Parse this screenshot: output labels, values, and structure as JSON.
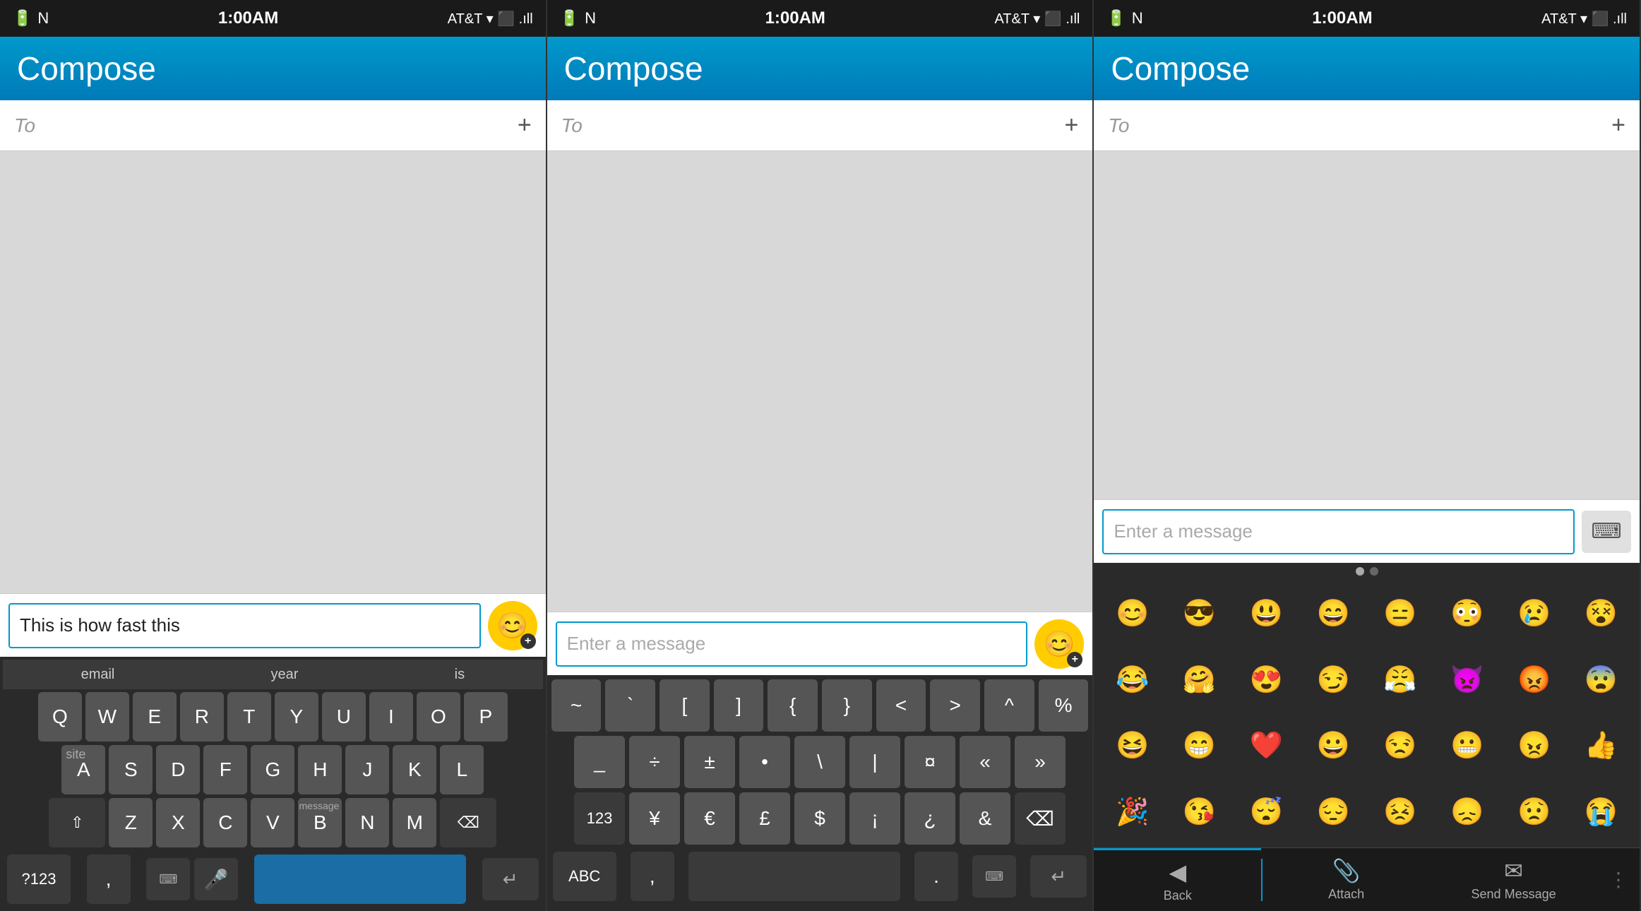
{
  "panels": [
    {
      "id": "panel1",
      "statusBar": {
        "left": "🔇 N",
        "time": "1:00AM",
        "right": "AT&T ▾ ⬛ .ıll"
      },
      "header": {
        "title": "Compose"
      },
      "toLabel": "To",
      "toPlus": "+",
      "messageInput": {
        "value": "This is how fast this",
        "placeholder": ""
      },
      "wordHints": [
        "email",
        "year",
        "is"
      ],
      "keyboard": "qwerty",
      "rows": [
        [
          "Q",
          "W",
          "E",
          "R",
          "T",
          "Y",
          "U",
          "I",
          "O",
          "P"
        ],
        [
          "A",
          "S",
          "D",
          "F",
          "G",
          "H",
          "J",
          "K",
          "L"
        ],
        [
          "⇧",
          "Z",
          "X",
          "C",
          "V",
          "B",
          "N",
          "M",
          "⌫"
        ]
      ],
      "bottomKeys": [
        "?123",
        ",",
        "⎵",
        "⌨",
        "🎤",
        "↵"
      ]
    },
    {
      "id": "panel2",
      "statusBar": {
        "left": "🔇 N",
        "time": "1:00AM",
        "right": "AT&T ▾ ⬛ .ıll"
      },
      "header": {
        "title": "Compose"
      },
      "toLabel": "To",
      "toPlus": "+",
      "messageInput": {
        "value": "",
        "placeholder": "Enter a message"
      },
      "keyboard": "symbol",
      "symRows": [
        [
          "~",
          "`",
          "[",
          "]",
          "{",
          "}",
          "<",
          ">",
          "^",
          "%"
        ],
        [
          "_",
          "÷",
          "±",
          "•",
          "\\",
          "|",
          "¤",
          "«",
          "»"
        ],
        [
          "123",
          "¥",
          "€",
          "£",
          "$",
          "¡",
          "¿",
          "&",
          "⌫"
        ]
      ],
      "bottomKeys": [
        "ABC",
        ",",
        "⎵",
        ".",
        "⌨",
        "↵"
      ]
    },
    {
      "id": "panel3",
      "statusBar": {
        "left": "🔇 N",
        "time": "1:00AM",
        "right": "AT&T ▾ ⬛ .ıll"
      },
      "header": {
        "title": "Compose"
      },
      "toLabel": "To",
      "toPlus": "+",
      "messageInput": {
        "value": "",
        "placeholder": "Enter a message"
      },
      "keyboard": "emoji",
      "emojis": [
        "😊",
        "😎",
        "😃",
        "😄",
        "😑",
        "😳",
        "😢",
        "😵",
        "😂",
        "🤗",
        "😍",
        "😏",
        "😤",
        "👿",
        "😡",
        "😨",
        "😆",
        "😁",
        "❤️",
        "😀",
        "😒",
        "😬",
        "😠",
        "👍",
        "🎉",
        "😘",
        "😴",
        "😔",
        "😣",
        "😞",
        "😟",
        "😭"
      ],
      "bottomBar": [
        {
          "icon": "◀",
          "label": "Back"
        },
        {
          "icon": "📎",
          "label": "Attach"
        },
        {
          "icon": "✉",
          "label": "Send Message"
        },
        {
          "icon": "⋮",
          "label": ""
        }
      ]
    }
  ]
}
